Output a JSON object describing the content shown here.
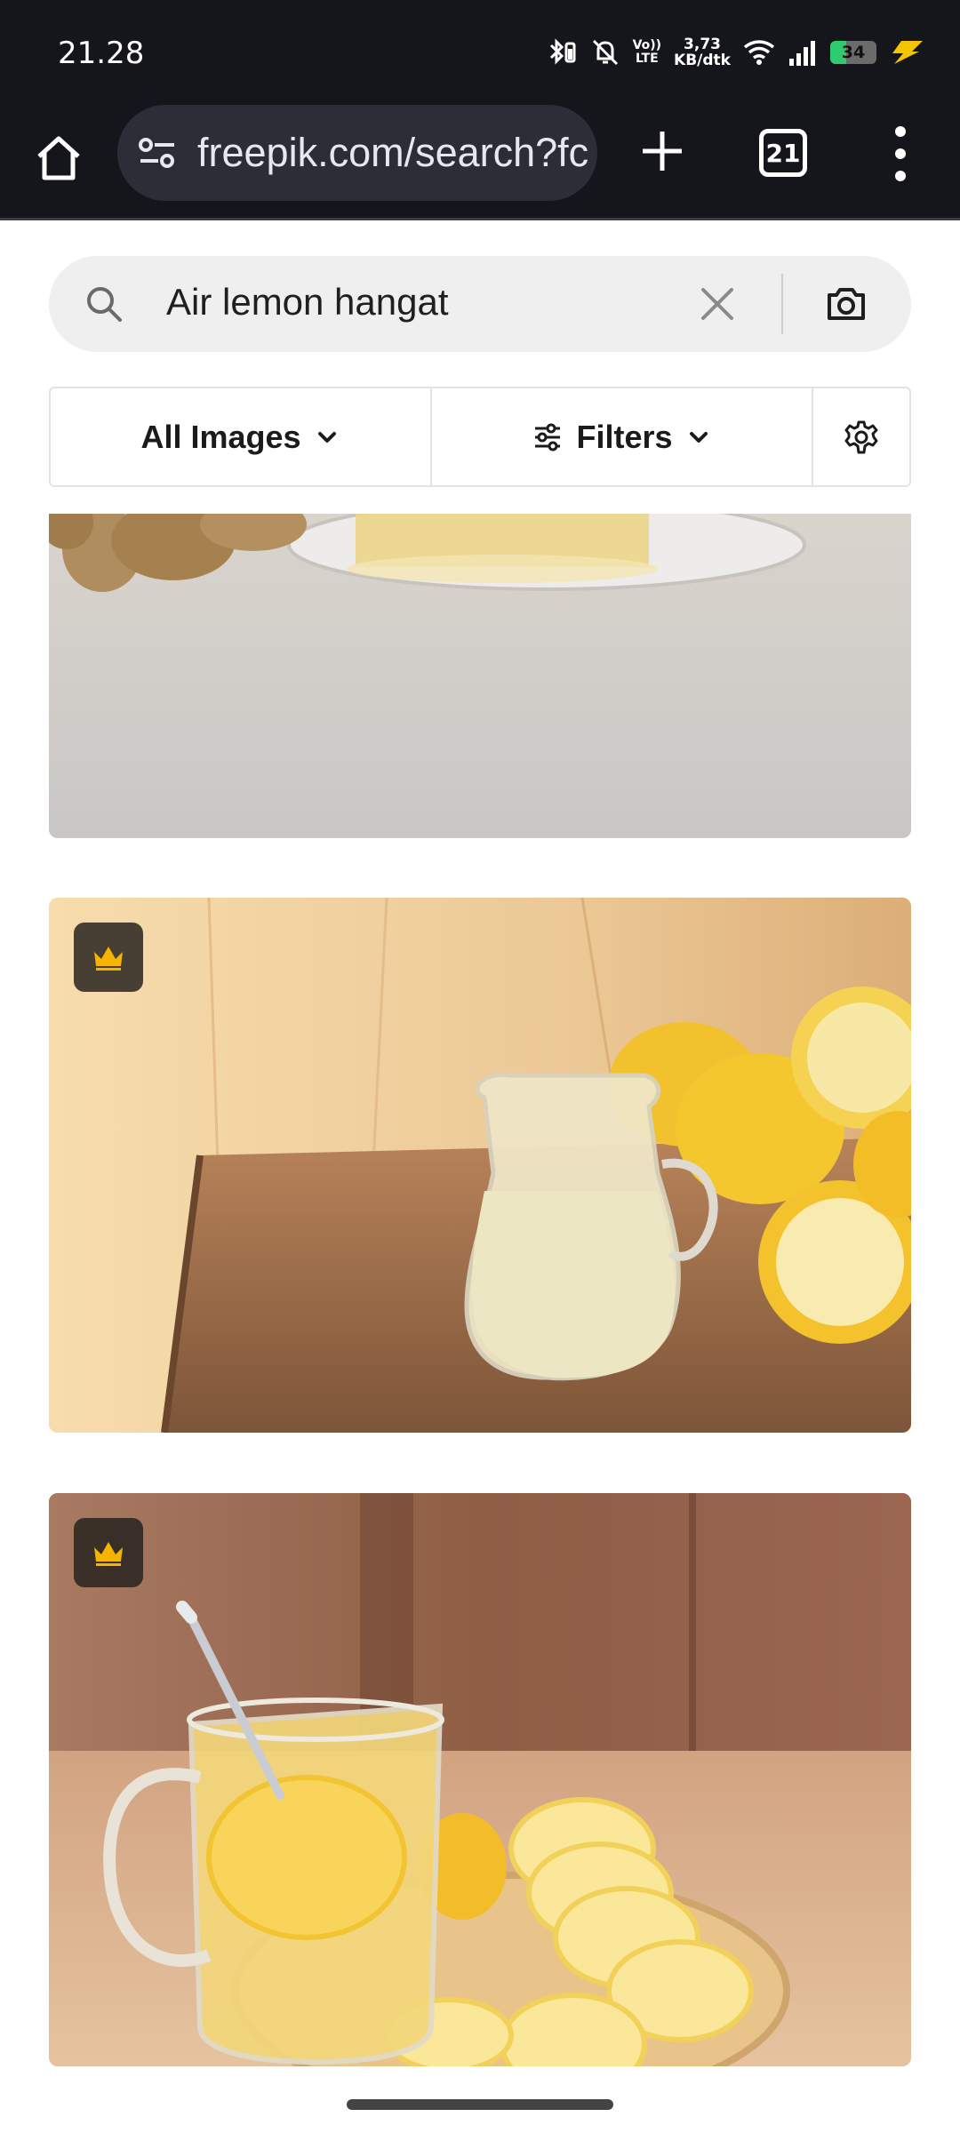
{
  "status_bar": {
    "time": "21.28",
    "volte_top": "Vo))",
    "volte_bottom": "LTE",
    "net_speed_value": "3,73",
    "net_speed_unit": "KB/dtk",
    "battery_level": "34"
  },
  "browser": {
    "url": "freepik.com/search?fc",
    "tab_count": "21"
  },
  "search": {
    "query": "Air lemon hangat"
  },
  "filters": {
    "images_label": "All Images",
    "filters_label": "Filters"
  },
  "results": [
    {
      "id": "result-ginger-tea",
      "premium": false
    },
    {
      "id": "result-lemon-juice-jug",
      "premium": true
    },
    {
      "id": "result-hot-lemon-tea",
      "premium": true
    }
  ],
  "colors": {
    "bar_bg": "#14161c",
    "url_bg": "#2b2e36",
    "search_bg": "#efefef",
    "crown": "#f5b400",
    "battery_fill": "#2ecc71",
    "charging": "#f5c400"
  }
}
